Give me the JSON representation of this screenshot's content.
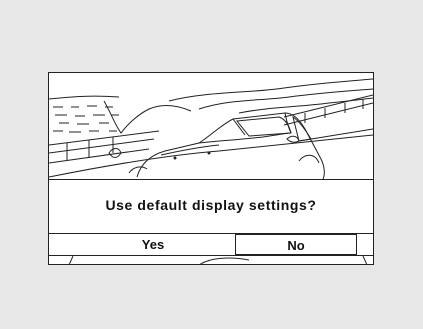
{
  "dialog": {
    "prompt": "Use default display settings?",
    "yes_label": "Yes",
    "no_label": "No",
    "selected": "No"
  },
  "scene": {
    "icon": "car-on-highway-illustration"
  }
}
